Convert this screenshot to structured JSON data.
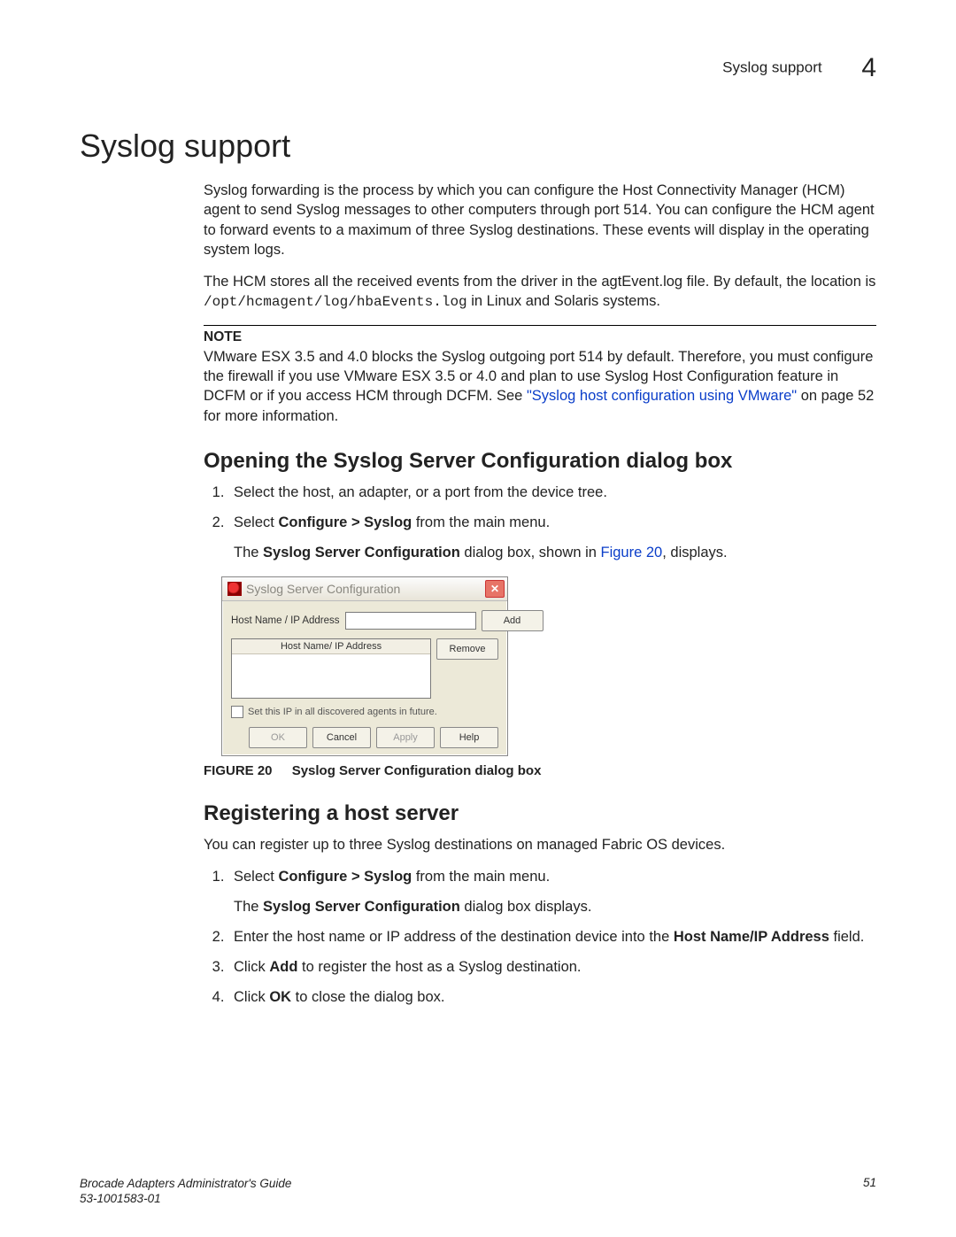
{
  "header": {
    "running": "Syslog support",
    "chapter": "4"
  },
  "h1": "Syslog support",
  "p1": "Syslog forwarding is the process by which you can configure the Host Connectivity Manager (HCM) agent to send Syslog messages to other computers through port 514. You can configure the HCM agent to forward events to a maximum of three Syslog destinations. These events will display in the operating system logs.",
  "p2a": "The HCM stores all the received events from the driver in the agtEvent.log file. By default, the location is ",
  "p2code": "/opt/hcmagent/log/hbaEvents.log",
  "p2b": " in Linux and Solaris systems.",
  "note": {
    "label": "NOTE",
    "textA": "VMware ESX 3.5 and 4.0 blocks the Syslog outgoing port 514 by default. Therefore, you must configure the firewall if you use VMware ESX 3.5 or 4.0 and plan to use Syslog Host Configuration feature in DCFM or if you access HCM through DCFM. See ",
    "link": "\"Syslog host configuration using VMware\"",
    "textB": " on page 52 for more information."
  },
  "sub1": {
    "title": "Opening the Syslog Server Configuration dialog box",
    "step1": "Select the host, an adapter, or a port from the device tree.",
    "step2a": "Select ",
    "step2bold": "Configure > Syslog",
    "step2b": " from the main menu.",
    "afterA": "The ",
    "afterBold": "Syslog Server Configuration",
    "afterB": " dialog box, shown in ",
    "afterLink": "Figure 20",
    "afterC": ", displays."
  },
  "dialog": {
    "title": "Syslog Server Configuration",
    "hostLabel": "Host Name / IP Address",
    "add": "Add",
    "listHeader": "Host Name/ IP Address",
    "remove": "Remove",
    "checkbox": "Set this IP in all discovered agents in future.",
    "ok": "OK",
    "cancel": "Cancel",
    "apply": "Apply",
    "help": "Help"
  },
  "figure": {
    "label": "FIGURE 20",
    "caption": "Syslog Server Configuration dialog box"
  },
  "sub2": {
    "title": "Registering a host server",
    "intro": "You can register up to three Syslog destinations on managed Fabric OS devices.",
    "s1a": "Select ",
    "s1bold": "Configure > Syslog",
    "s1b": " from the main menu.",
    "s1subA": "The ",
    "s1subBold": "Syslog Server Configuration",
    "s1subB": " dialog box displays.",
    "s2a": "Enter the host name or IP address of the destination device into the ",
    "s2bold": "Host Name/IP Address",
    "s2b": " field.",
    "s3a": "Click ",
    "s3bold": "Add",
    "s3b": " to register the host as a Syslog destination.",
    "s4a": "Click ",
    "s4bold": "OK",
    "s4b": " to close the dialog box."
  },
  "footer": {
    "line1": "Brocade Adapters Administrator's Guide",
    "line2": "53-1001583-01",
    "page": "51"
  }
}
